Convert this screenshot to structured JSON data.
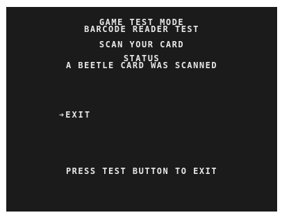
{
  "screen": {
    "title": "GAME TEST MODE",
    "subtitle": "BARCODE READER TEST",
    "instruction": "SCAN YOUR CARD",
    "status_label": "STATUS",
    "status_message": "A BEETLE CARD WAS SCANNED",
    "menu": {
      "cursor": "➔",
      "exit_label": "EXIT"
    },
    "footer": "PRESS TEST BUTTON TO EXIT"
  },
  "colors": {
    "background": "#1b1b1b",
    "text": "#e7e7e7"
  }
}
